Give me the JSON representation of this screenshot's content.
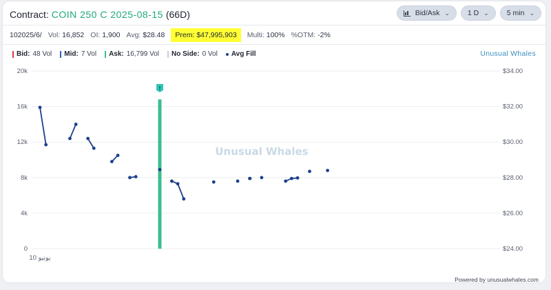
{
  "header": {
    "title_prefix": "Contract: ",
    "contract": "COIN 250 C 2025-08-15",
    "dte": "(66D)",
    "controls": [
      {
        "label": "Bid/Ask",
        "icon": "bar-chart-icon"
      },
      {
        "label": "1 D",
        "icon": ""
      },
      {
        "label": "5 min",
        "icon": ""
      }
    ]
  },
  "stats": {
    "date": "102025/6/",
    "vol_label": "Vol:",
    "vol": "16,852",
    "oi_label": "OI:",
    "oi": "1,900",
    "avg_label": "Avg:",
    "avg": "$28.48",
    "prem_label": "Prem:",
    "prem": "$47,995,903",
    "multi_label": "Multi:",
    "multi": "100%",
    "otm_label": "%OTM:",
    "otm": "-2%"
  },
  "legend": {
    "bid": {
      "label": "Bid:",
      "value": "48 Vol",
      "color": "#e0344b"
    },
    "mid": {
      "label": "Mid:",
      "value": "7 Vol",
      "color": "#2a63c6"
    },
    "ask": {
      "label": "Ask:",
      "value": "16,799 Vol",
      "color": "#3bbf8f"
    },
    "noside": {
      "label": "No Side:",
      "value": "0 Vol",
      "color": "#c8ccd4"
    },
    "avgfill": {
      "label": "Avg Fill",
      "color": "#1c3f8c"
    }
  },
  "brand": "Unusual Whales",
  "watermark": "Unusual Whales",
  "powered_by": "Powered by unusualwhales.com",
  "chart_data": {
    "type": "bar",
    "x_tick_labels": [
      "10 يونيو"
    ],
    "left_axis": {
      "ticks": [
        "0",
        "4k",
        "8k",
        "12k",
        "16k",
        "20k"
      ],
      "min": 0,
      "max": 20000
    },
    "right_axis": {
      "ticks": [
        "$24.00",
        "$26.00",
        "$28.00",
        "$30.00",
        "$32.00",
        "$34.00"
      ],
      "min": 24,
      "max": 34
    },
    "volume_bars": [
      {
        "bar": 20,
        "value": 16799,
        "side": "ask",
        "color": "#3bbf8f"
      }
    ],
    "flag_marker": {
      "bar": 20,
      "label": "!",
      "color": "#2ec6b8"
    },
    "avg_fill_series": {
      "name": "Avg Fill",
      "color": "#1c3f8c",
      "segments": [
        [
          {
            "bar": 0,
            "y": 31.95
          },
          {
            "bar": 1,
            "y": 29.85
          }
        ],
        [
          {
            "bar": 5,
            "y": 30.2
          },
          {
            "bar": 6,
            "y": 31.0
          }
        ],
        [
          {
            "bar": 8,
            "y": 30.2
          },
          {
            "bar": 9,
            "y": 29.65
          }
        ],
        [
          {
            "bar": 12,
            "y": 28.9
          },
          {
            "bar": 13,
            "y": 29.25
          }
        ],
        [
          {
            "bar": 15,
            "y": 28.0
          },
          {
            "bar": 16,
            "y": 28.05
          }
        ],
        [
          {
            "bar": 20,
            "y": 28.45
          }
        ],
        [
          {
            "bar": 22,
            "y": 27.8
          },
          {
            "bar": 23,
            "y": 27.65
          },
          {
            "bar": 24,
            "y": 26.8
          }
        ],
        [
          {
            "bar": 29,
            "y": 27.75
          }
        ],
        [
          {
            "bar": 33,
            "y": 27.8
          }
        ],
        [
          {
            "bar": 35,
            "y": 27.95
          },
          {
            "bar": 35.05,
            "y": 27.95
          }
        ],
        [
          {
            "bar": 37,
            "y": 28.0
          }
        ],
        [
          {
            "bar": 41,
            "y": 27.8
          },
          {
            "bar": 42,
            "y": 27.95
          },
          {
            "bar": 43,
            "y": 27.98
          }
        ],
        [
          {
            "bar": 45,
            "y": 28.35
          }
        ],
        [
          {
            "bar": 48,
            "y": 28.4
          }
        ]
      ]
    },
    "grid": true
  }
}
